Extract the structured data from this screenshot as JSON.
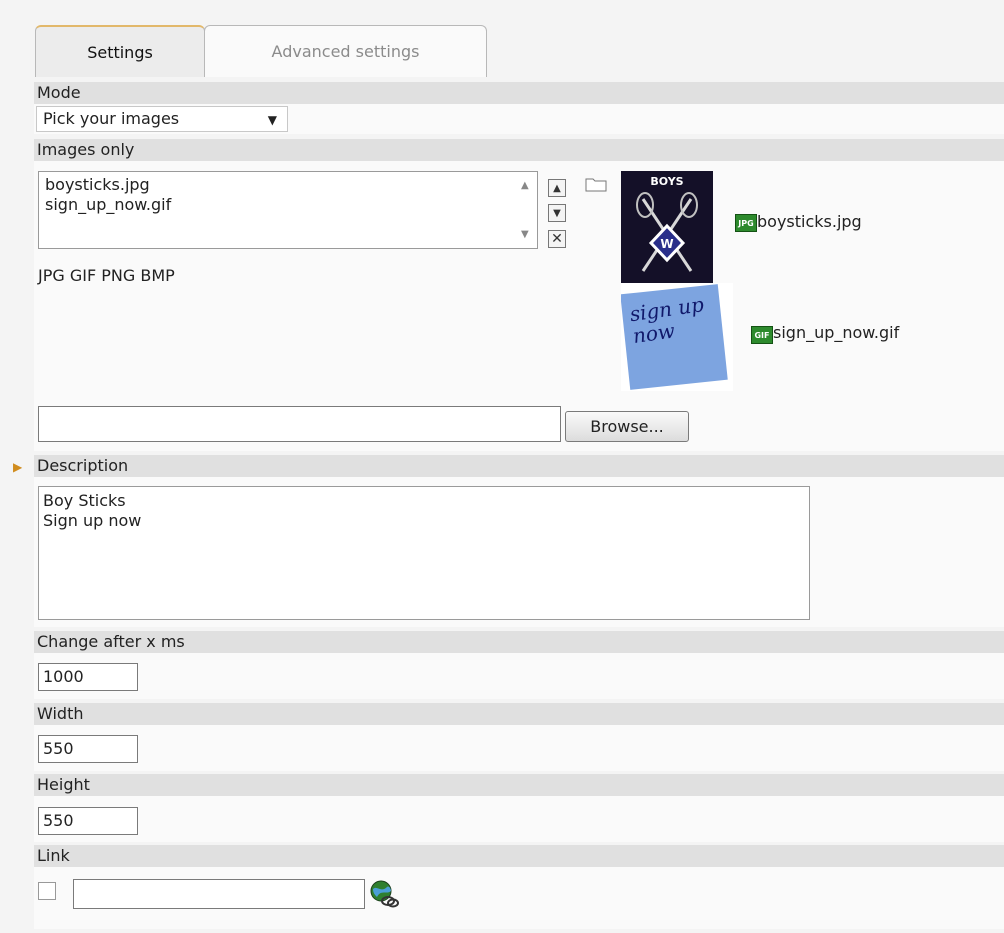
{
  "tabs": [
    {
      "label": "Settings"
    },
    {
      "label": "Advanced settings"
    }
  ],
  "mode": {
    "label": "Mode",
    "selected": "Pick your images"
  },
  "images": {
    "label": "Images only",
    "files": [
      "boysticks.jpg",
      "sign_up_now.gif"
    ],
    "allowed_types": "JPG GIF PNG BMP",
    "previews": [
      {
        "name": "boysticks.jpg",
        "type": "JPG",
        "thumb_text": "BOYS"
      },
      {
        "name": "sign_up_now.gif",
        "type": "GIF",
        "thumb_text": "sign up now"
      }
    ],
    "browse_label": "Browse..."
  },
  "description": {
    "label": "Description",
    "text": "Boy Sticks\nSign up now"
  },
  "change_after": {
    "label": "Change after x ms",
    "value": "1000"
  },
  "width": {
    "label": "Width",
    "value": "550"
  },
  "height": {
    "label": "Height",
    "value": "550"
  },
  "link": {
    "label": "Link",
    "value": ""
  }
}
